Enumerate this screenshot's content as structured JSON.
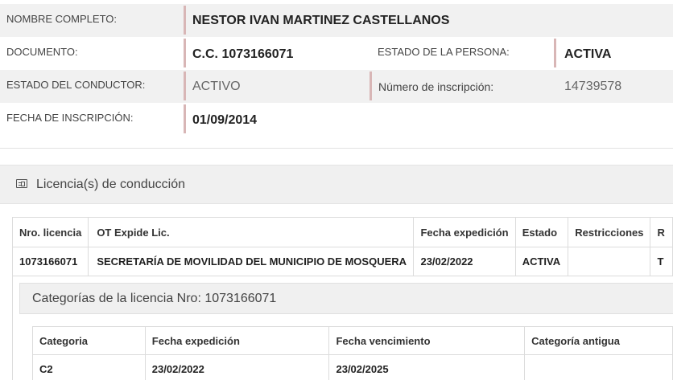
{
  "person": {
    "nombre_label": "NOMBRE COMPLETO:",
    "nombre_value": "NESTOR IVAN MARTINEZ CASTELLANOS",
    "documento_label": "DOCUMENTO:",
    "documento_value": "C.C. 1073166071",
    "estado_persona_label": "ESTADO DE LA PERSONA:",
    "estado_persona_value": "ACTIVA",
    "estado_conductor_label": "ESTADO DEL CONDUCTOR:",
    "estado_conductor_value": "ACTIVO",
    "inscripcion_label": "Número de inscripción:",
    "inscripcion_value": "14739578",
    "fecha_label": "FECHA DE INSCRIPCIÓN:",
    "fecha_value": "01/09/2014"
  },
  "licencias": {
    "title": "Licencia(s) de conducción",
    "icon": "id-card-icon",
    "headers": [
      "Nro. licencia",
      "OT Expide Lic.",
      "Fecha expedición",
      "Estado",
      "Restricciones",
      "R"
    ],
    "rows": [
      [
        "1073166071",
        "SECRETARÍA DE MOVILIDAD DEL MUNICIPIO DE MOSQUERA",
        "23/02/2022",
        "ACTIVA",
        "",
        "T"
      ]
    ]
  },
  "categorias": {
    "title": "Categorías de la licencia Nro: 1073166071",
    "headers": [
      "Categoria",
      "Fecha expedición",
      "Fecha vencimiento",
      "Categoría antigua"
    ],
    "rows": [
      [
        "C2",
        "23/02/2022",
        "23/02/2025",
        ""
      ]
    ]
  }
}
